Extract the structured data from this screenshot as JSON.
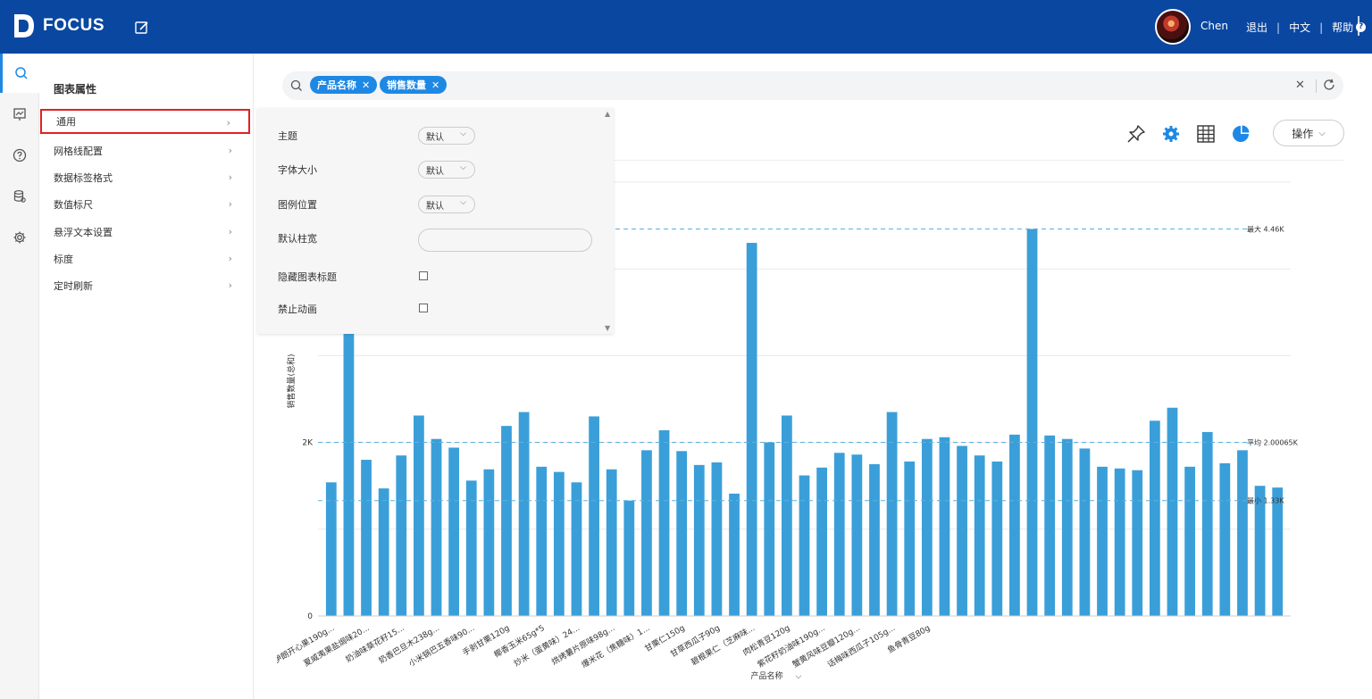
{
  "header": {
    "brand": "FOCUS",
    "username": "Chen",
    "logout": "退出",
    "language": "中文",
    "help": "帮助",
    "help_symbol": "?"
  },
  "props": {
    "title": "图表属性",
    "items": [
      "通用",
      "网格线配置",
      "数据标签格式",
      "数值标尺",
      "悬浮文本设置",
      "标度",
      "定时刷新"
    ]
  },
  "search": {
    "tags": [
      "产品名称",
      "销售数量"
    ]
  },
  "dropdown": {
    "theme_label": "主题",
    "theme_value": "默认",
    "fontsize_label": "字体大小",
    "fontsize_value": "默认",
    "legend_label": "图例位置",
    "legend_value": "默认",
    "barwidth_label": "默认柱宽",
    "hide_title_label": "隐藏图表标题",
    "disable_anim_label": "禁止动画"
  },
  "toolbar": {
    "operations": "操作"
  },
  "colors": {
    "brand": "#0a47a1",
    "accent": "#1e88e5",
    "bar": "#3a9fd9",
    "refline": "#5ab0e0"
  },
  "chart_data": {
    "type": "bar",
    "xlabel": "产品名称",
    "ylabel": "销售数量(总和)",
    "ylim": [
      0,
      5000
    ],
    "yticks": [
      {
        "value": 0,
        "label": "0"
      },
      {
        "value": 2000,
        "label": "2K"
      }
    ],
    "categories": [
      "伊朗开心果190g...",
      "",
      "夏威夷果盐焗味20...",
      "",
      "奶油味葵花籽15...",
      "",
      "奶香巴旦木238g...",
      "",
      "小米锅巴五香味90...",
      "",
      "手剥甘栗120g",
      "",
      "椰香玉米65g*5",
      "",
      "炒米（蛋黄味）24...",
      "",
      "烘烤薯片原味98g...",
      "",
      "爆米花（焦糖味）1...",
      "",
      "甘栗仁150g",
      "",
      "甘草西瓜子90g",
      "",
      "碧根果仁（芝麻味...",
      "",
      "肉松青豆120g",
      "",
      "紫花籽奶油味190g...",
      "",
      "蟹黄风味豆瓣120g...",
      "",
      "话梅味西瓜子105g...",
      "",
      "鱼骨青豆80g",
      ""
    ],
    "values": [
      1540,
      3960,
      1800,
      1470,
      1850,
      2310,
      2040,
      1940,
      1560,
      1690,
      2190,
      2350,
      1720,
      1660,
      1540,
      2300,
      1690,
      1330,
      1910,
      2140,
      1900,
      1740,
      1770,
      1410,
      4300,
      2000,
      2310,
      1620,
      1710,
      1880,
      1860,
      1750,
      2350,
      1780,
      2040,
      2060,
      1960,
      1850,
      1780,
      2090,
      4460,
      2080,
      2040,
      1930,
      1720,
      1700,
      1680,
      2250,
      2400,
      1720,
      2120,
      1760,
      1910,
      1500,
      1480
    ],
    "reference_lines": [
      {
        "label": "最大 4.46K",
        "value": 4460
      },
      {
        "label": "平均 2.00065K",
        "value": 2000.65
      },
      {
        "label": "最小 1.33K",
        "value": 1330
      }
    ]
  }
}
